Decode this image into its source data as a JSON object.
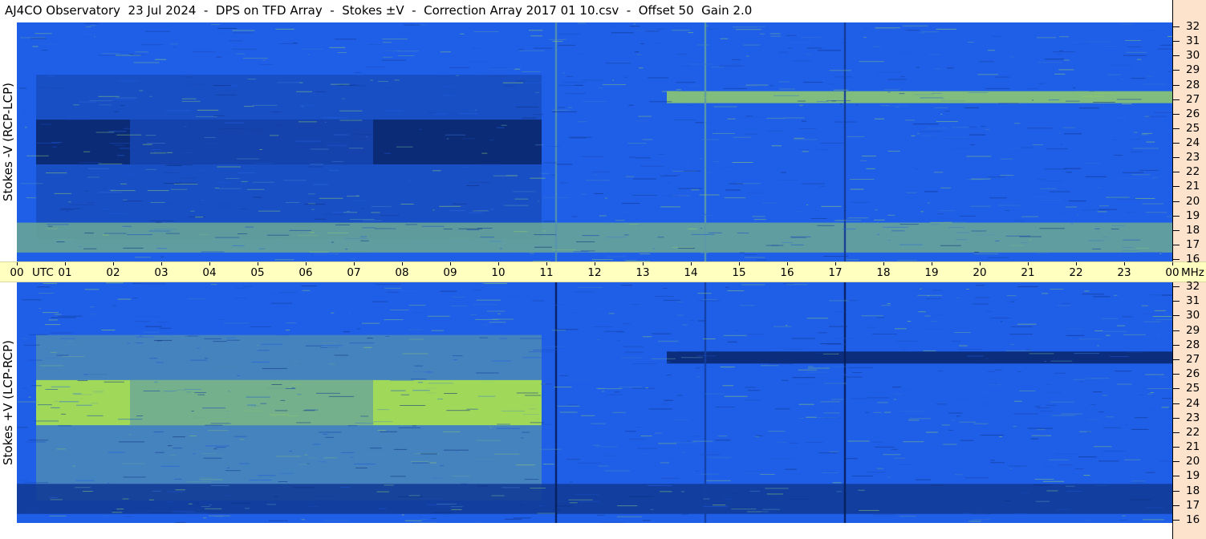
{
  "header": {
    "title": "AJ4CO Observatory  23 Jul 2024  -  DPS on TFD Array  -  Stokes ±V  -  Correction Array 2017 01 10.csv  -  Offset 50  Gain 2.0"
  },
  "panels": {
    "top": {
      "ylabel": "Stokes -V (RCP-LCP)"
    },
    "bottom": {
      "ylabel": "Stokes +V (LCP-RCP)"
    }
  },
  "time_axis": {
    "utc_label": "UTC",
    "unit_label": "MHz"
  },
  "colors": {
    "axis_background": "#ffffc0",
    "freq_axis_background": "#fde3cc",
    "spectrogram_base": "#1f5fe8",
    "spectrogram_dark": "#071e5a",
    "spectrogram_bright": "#b8f040"
  },
  "chart_data": {
    "type": "heatmap",
    "title": "AJ4CO Observatory  23 Jul 2024  -  DPS on TFD Array  -  Stokes ±V  -  Correction Array 2017 01 10.csv  -  Offset 50  Gain 2.0",
    "x_ticks": [
      "00",
      "01",
      "02",
      "03",
      "04",
      "05",
      "06",
      "07",
      "08",
      "09",
      "10",
      "11",
      "12",
      "13",
      "14",
      "15",
      "16",
      "17",
      "18",
      "19",
      "20",
      "21",
      "22",
      "23",
      "00"
    ],
    "y_ticks": [
      "16",
      "17",
      "18",
      "19",
      "20",
      "21",
      "22",
      "23",
      "24",
      "25",
      "26",
      "27",
      "28",
      "29",
      "30",
      "31",
      "32"
    ],
    "xlabel": "UTC",
    "ylabel_unit": "MHz",
    "xlim": [
      0,
      24
    ],
    "ylim": [
      16,
      32
    ],
    "series": [
      {
        "name": "Stokes -V (RCP-LCP)",
        "features": [
          {
            "kind": "dark-band",
            "t_start": 0.4,
            "t_end": 10.9,
            "f_low": 22.5,
            "f_high": 25.5,
            "level": -0.9
          },
          {
            "kind": "dark-region",
            "t_start": 0.4,
            "t_end": 10.9,
            "f_low": 17.5,
            "f_high": 28.5,
            "level": -0.45
          },
          {
            "kind": "lighter-gap",
            "t_start": 2.35,
            "t_end": 7.4,
            "f_low": 22.5,
            "f_high": 25.5,
            "level": -0.35
          },
          {
            "kind": "bright-band",
            "t_start": 13.5,
            "t_end": 24.0,
            "f_low": 26.6,
            "f_high": 27.4,
            "level": 0.75
          },
          {
            "kind": "bright-band",
            "t_start": 0.0,
            "t_end": 24.0,
            "f_low": 16.6,
            "f_high": 18.6,
            "level": 0.5
          },
          {
            "kind": "vertical-line",
            "t": 11.2,
            "level": 0.35
          },
          {
            "kind": "vertical-line",
            "t": 17.2,
            "level": -0.6
          },
          {
            "kind": "vertical-line",
            "t": 14.3,
            "level": 0.4
          }
        ]
      },
      {
        "name": "Stokes +V (LCP-RCP)",
        "features": [
          {
            "kind": "bright-band",
            "t_start": 0.4,
            "t_end": 10.9,
            "f_low": 22.5,
            "f_high": 25.5,
            "level": 0.95
          },
          {
            "kind": "bright-region",
            "t_start": 0.4,
            "t_end": 10.9,
            "f_low": 17.5,
            "f_high": 28.5,
            "level": 0.45
          },
          {
            "kind": "dimmer-gap",
            "t_start": 2.35,
            "t_end": 7.4,
            "f_low": 22.5,
            "f_high": 25.5,
            "level": 0.5
          },
          {
            "kind": "dark-band",
            "t_start": 13.5,
            "t_end": 24.0,
            "f_low": 26.6,
            "f_high": 27.4,
            "level": -0.9
          },
          {
            "kind": "dark-band",
            "t_start": 0.0,
            "t_end": 24.0,
            "f_low": 16.6,
            "f_high": 18.6,
            "level": -0.6
          },
          {
            "kind": "vertical-line",
            "t": 11.2,
            "level": -1.0
          },
          {
            "kind": "vertical-line",
            "t": 17.2,
            "level": -1.0
          },
          {
            "kind": "vertical-line",
            "t": 14.3,
            "level": -0.5
          }
        ]
      }
    ]
  }
}
